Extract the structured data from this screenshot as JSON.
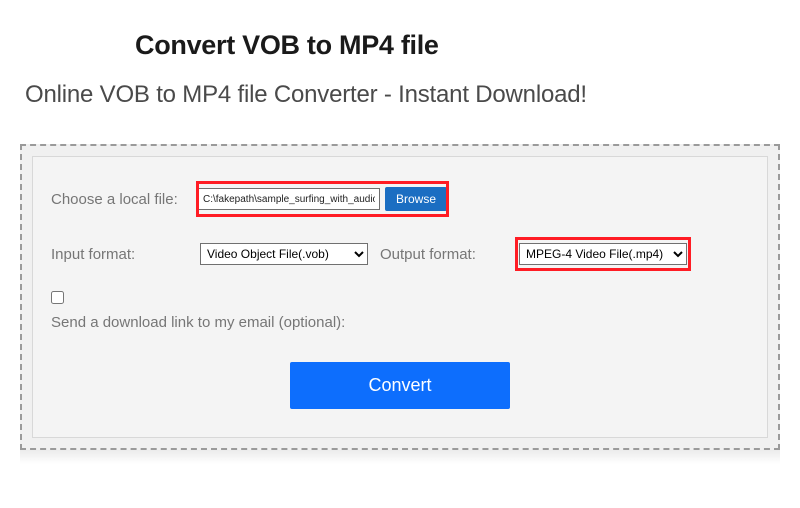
{
  "title": "Convert VOB to MP4 file",
  "subtitle": "Online VOB to MP4 file Converter - Instant Download!",
  "file": {
    "label": "Choose a local file:",
    "value": "C:\\fakepath\\sample_surfing_with_audio.vob",
    "browse": "Browse"
  },
  "input_format": {
    "label": "Input format:",
    "selected": "Video Object File(.vob)"
  },
  "output_format": {
    "label": "Output format:",
    "selected": "MPEG-4 Video File(.mp4)"
  },
  "email": {
    "label": "Send a download link to my email (optional):"
  },
  "submit": "Convert"
}
